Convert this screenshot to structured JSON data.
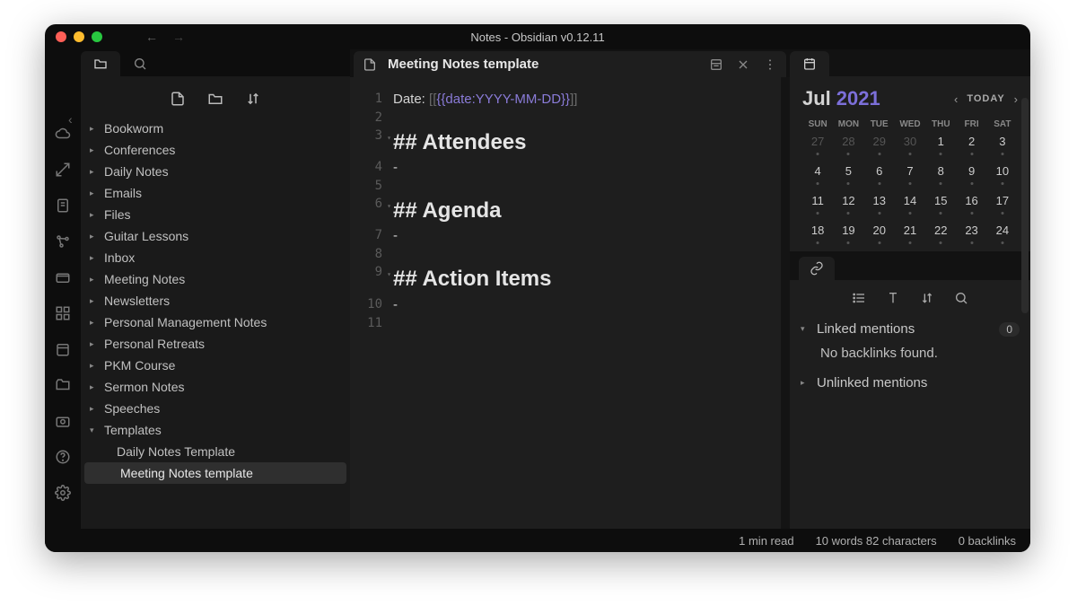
{
  "window": {
    "title": "Notes - Obsidian v0.12.11"
  },
  "sidebar": {
    "folders": [
      "Bookworm",
      "Conferences",
      "Daily Notes",
      "Emails",
      "Files",
      "Guitar Lessons",
      "Inbox",
      "Meeting Notes",
      "Newsletters",
      "Personal Management Notes",
      "Personal Retreats",
      "PKM Course",
      "Sermon Notes",
      "Speeches",
      "Templates"
    ],
    "templates_children": [
      "Daily Notes Template",
      "Meeting Notes template"
    ],
    "active_child": "Meeting Notes template"
  },
  "editor": {
    "tab_title": "Meeting Notes template",
    "lines": {
      "l1_prefix": "Date: ",
      "l1_open": "[[",
      "l1_var": "{{date:YYYY-MM-DD}}",
      "l1_close": "]]",
      "l3": "## Attendees",
      "l4": "-",
      "l6": "## Agenda",
      "l7": "-",
      "l9": "## Action Items",
      "l10": "-"
    }
  },
  "calendar": {
    "month": "Jul",
    "year": "2021",
    "today_label": "TODAY",
    "dow": [
      "SUN",
      "MON",
      "TUE",
      "WED",
      "THU",
      "FRI",
      "SAT"
    ],
    "weeks": [
      [
        {
          "d": "27",
          "o": true
        },
        {
          "d": "28",
          "o": true
        },
        {
          "d": "29",
          "o": true
        },
        {
          "d": "30",
          "o": true
        },
        {
          "d": "1"
        },
        {
          "d": "2"
        },
        {
          "d": "3"
        }
      ],
      [
        {
          "d": "4"
        },
        {
          "d": "5"
        },
        {
          "d": "6"
        },
        {
          "d": "7"
        },
        {
          "d": "8"
        },
        {
          "d": "9"
        },
        {
          "d": "10"
        }
      ],
      [
        {
          "d": "11"
        },
        {
          "d": "12"
        },
        {
          "d": "13"
        },
        {
          "d": "14"
        },
        {
          "d": "15"
        },
        {
          "d": "16"
        },
        {
          "d": "17"
        }
      ],
      [
        {
          "d": "18"
        },
        {
          "d": "19"
        },
        {
          "d": "20"
        },
        {
          "d": "21"
        },
        {
          "d": "22"
        },
        {
          "d": "23"
        },
        {
          "d": "24"
        }
      ]
    ]
  },
  "backlinks": {
    "linked_label": "Linked mentions",
    "linked_count": "0",
    "empty_text": "No backlinks found.",
    "unlinked_label": "Unlinked mentions"
  },
  "status": {
    "read_time": "1 min read",
    "wordcount": "10 words 82 characters",
    "backlinks": "0 backlinks"
  }
}
